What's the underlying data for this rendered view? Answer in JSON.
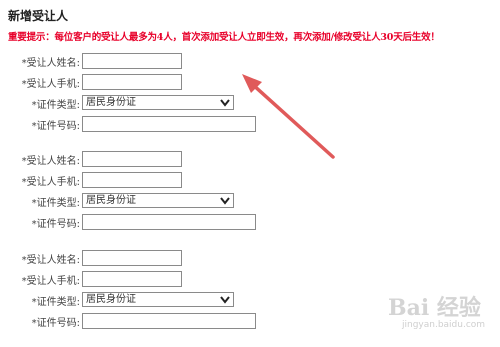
{
  "page": {
    "title": "新增受让人",
    "notice": "重要提示：每位客户的受让人最多为4人，首次添加受让人立即生效，再次添加/修改受让人30天后生效！"
  },
  "form": {
    "labels": {
      "name": "*受让人姓名:",
      "phone": "*受让人手机:",
      "id_type": "*证件类型:",
      "id_number": "*证件号码:"
    },
    "groups": [
      {
        "name": "",
        "phone": "",
        "id_type": "居民身份证",
        "id_number": ""
      },
      {
        "name": "",
        "phone": "",
        "id_type": "居民身份证",
        "id_number": ""
      },
      {
        "name": "",
        "phone": "",
        "id_type": "居民身份证",
        "id_number": ""
      }
    ]
  },
  "annotation": {
    "arrow_color": "#e05a5a"
  },
  "watermark": {
    "text": "Bai 经验",
    "sub": "jingyan.baidu.com"
  },
  "colors": {
    "notice": "#e8002a",
    "border": "#8a8a8a"
  }
}
